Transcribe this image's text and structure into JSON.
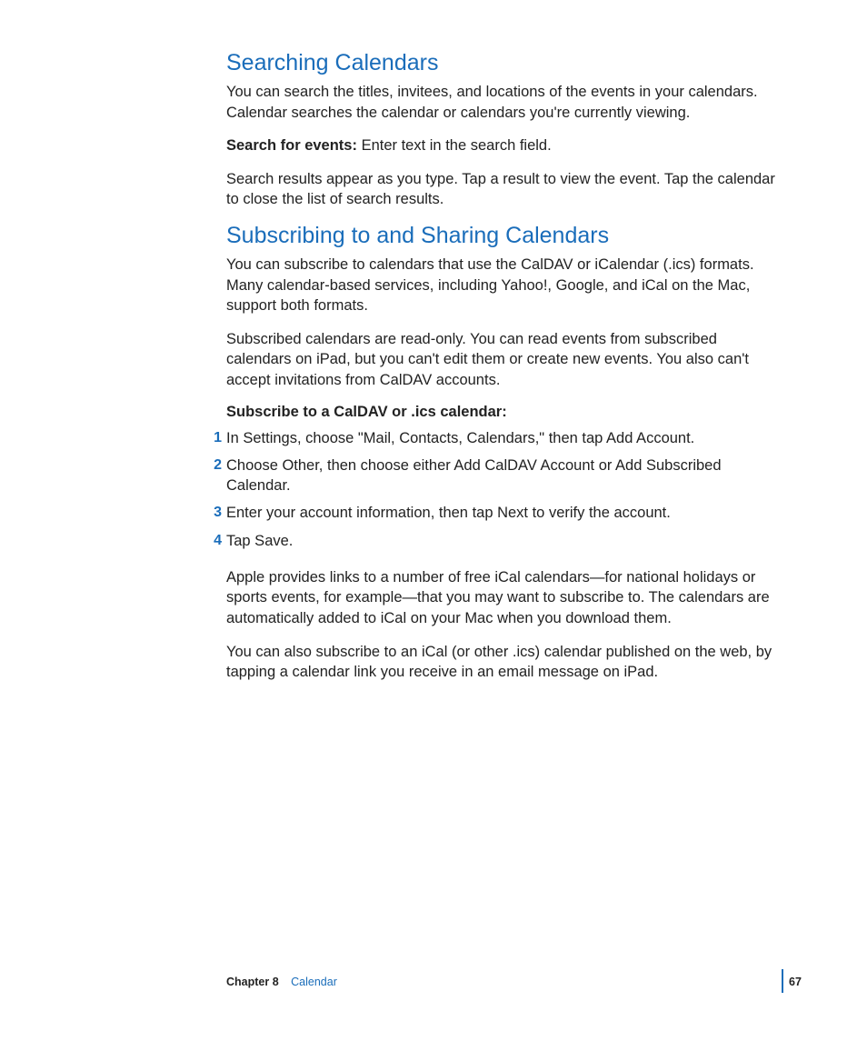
{
  "section1": {
    "heading": "Searching Calendars",
    "p1": "You can search the titles, invitees, and locations of the events in your calendars. Calendar searches the calendar or calendars you're currently viewing.",
    "p2_runin": "Search for events:",
    "p2_body": "  Enter text in the search field.",
    "p3": "Search results appear as you type. Tap a result to view the event. Tap the calendar to close the list of search results."
  },
  "section2": {
    "heading": "Subscribing to and Sharing Calendars",
    "p1": "You can subscribe to calendars that use the CalDAV or iCalendar (.ics) formats. Many calendar-based services, including Yahoo!, Google, and iCal on the Mac, support both formats.",
    "p2": "Subscribed calendars are read-only. You can read events from subscribed calendars on iPad, but you can't edit them or create new events. You also can't accept invitations from CalDAV accounts.",
    "steps_intro": "Subscribe to a CalDAV or .ics calendar:",
    "steps": [
      "In Settings, choose \"Mail, Contacts, Calendars,\" then tap Add Account.",
      "Choose Other, then choose either Add CalDAV Account or Add Subscribed Calendar.",
      "Enter your account information, then tap Next to verify the account.",
      "Tap Save."
    ],
    "p3": "Apple provides links to a number of free iCal calendars—for national holidays or sports events, for example—that you may want to subscribe to. The calendars are automatically added to iCal on your Mac when you download them.",
    "p4": "You can also subscribe to an iCal (or other .ics) calendar published on the web, by tapping a calendar link you receive in an email message on iPad."
  },
  "footer": {
    "chapter_label": "Chapter 8",
    "chapter_name": "Calendar",
    "page_number": "67"
  }
}
